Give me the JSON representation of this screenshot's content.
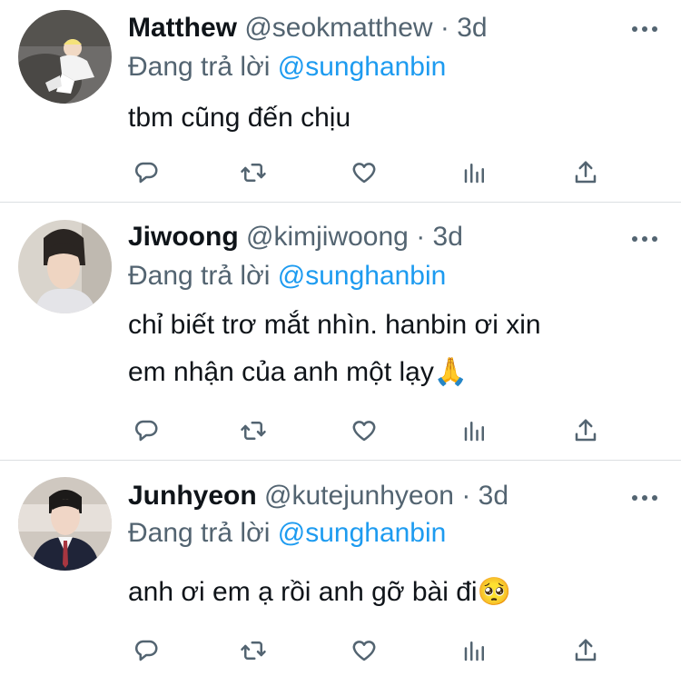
{
  "tweets": [
    {
      "name": "Matthew",
      "handle": "@seokmatthew",
      "separator": "·",
      "time": "3d",
      "replying_prefix": "Đang trả lời",
      "replying_to": "@sunghanbin",
      "lines": [
        "tbm cũng đến chịu"
      ]
    },
    {
      "name": "Jiwoong",
      "handle": "@kimjiwoong",
      "separator": "·",
      "time": "3d",
      "replying_prefix": "Đang trả lời",
      "replying_to": "@sunghanbin",
      "lines": [
        "chỉ biết trơ mắt nhìn. hanbin ơi xin",
        "em nhận của anh một lạy🙏"
      ]
    },
    {
      "name": "Junhyeon",
      "handle": "@kutejunhyeon",
      "separator": "·",
      "time": "3d",
      "replying_prefix": "Đang trả lời",
      "replying_to": "@sunghanbin",
      "lines": [
        "anh ơi em ạ rồi anh gỡ bài đi🥺"
      ]
    }
  ],
  "icons": {
    "reply": "reply-icon",
    "retweet": "retweet-icon",
    "like": "heart-icon",
    "views": "views-icon",
    "share": "share-icon",
    "more": "more-icon"
  },
  "colors": {
    "name": "#0f1419",
    "meta": "#536471",
    "mention": "#1d9bf0",
    "divider": "#dcdfe2"
  }
}
